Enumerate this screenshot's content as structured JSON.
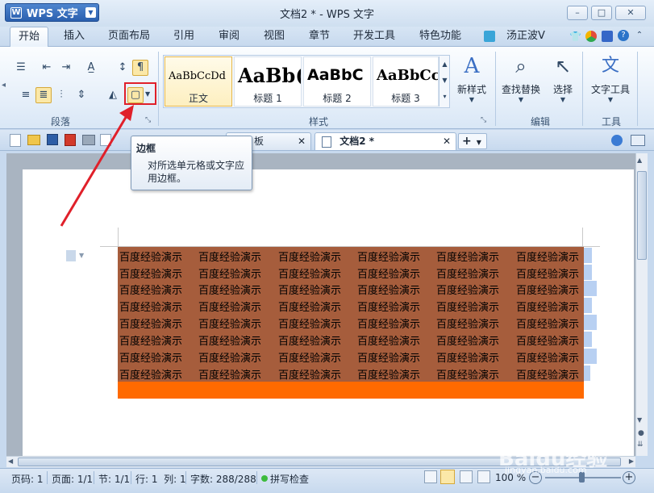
{
  "app": {
    "button_label": "WPS 文字",
    "title": "文档2 * - WPS 文字"
  },
  "window": {
    "minimize": "–",
    "maximize": "□",
    "close": "✕"
  },
  "menu": {
    "tabs": [
      "开始",
      "插入",
      "页面布局",
      "引用",
      "审阅",
      "视图",
      "章节",
      "开发工具",
      "特色功能"
    ],
    "active": "开始",
    "user": "汤正波V"
  },
  "ribbon": {
    "groups": {
      "paragraph": "段落",
      "styles": "样式",
      "edit": "编辑",
      "tools": "工具"
    },
    "styles": [
      {
        "sample": "AaBbCcDd",
        "name": "正文"
      },
      {
        "sample": "AaBb(",
        "name": "标题 1"
      },
      {
        "sample": "AaBbC",
        "name": "标题 2"
      },
      {
        "sample": "AaBbCc",
        "name": "标题 3"
      }
    ],
    "new_style": "新样式",
    "find_replace": "查找替换",
    "select": "选择",
    "text_tools": "文字工具"
  },
  "doc_tabs": [
    {
      "label": "板"
    },
    {
      "label": "文档2 *"
    }
  ],
  "tooltip": {
    "title": "边框",
    "description": "对所选单元格或文字应用边框。"
  },
  "table": {
    "cell_text": "百度经验演示",
    "rows": 8,
    "cols": 6
  },
  "status": {
    "page_num": "页码: 1",
    "page": "页面: 1/1",
    "section": "节: 1/1",
    "row_col": "行: 1  列: 1",
    "word_count": "字数: 288/288",
    "spell_check": "拼写检查",
    "zoom": "100 %"
  },
  "watermark": {
    "brand": "Baidu经验",
    "url": "jingyan.baidu.com"
  },
  "colors": {
    "table_fill": "#a65d3c",
    "orange_row": "#ff6a00",
    "highlight": "#e0202a",
    "arrow": "#e0202a"
  }
}
